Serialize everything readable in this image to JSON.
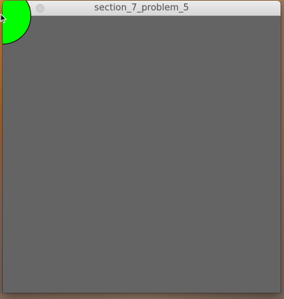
{
  "window": {
    "title": "section_7_problem_5"
  },
  "canvas": {
    "background_color": "#646464"
  },
  "shapes": [
    {
      "name": "green-circle",
      "fill_color": "#00ff00",
      "stroke_color": "#000000"
    }
  ],
  "cursor": {
    "type": "arrow-pointer-icon"
  }
}
